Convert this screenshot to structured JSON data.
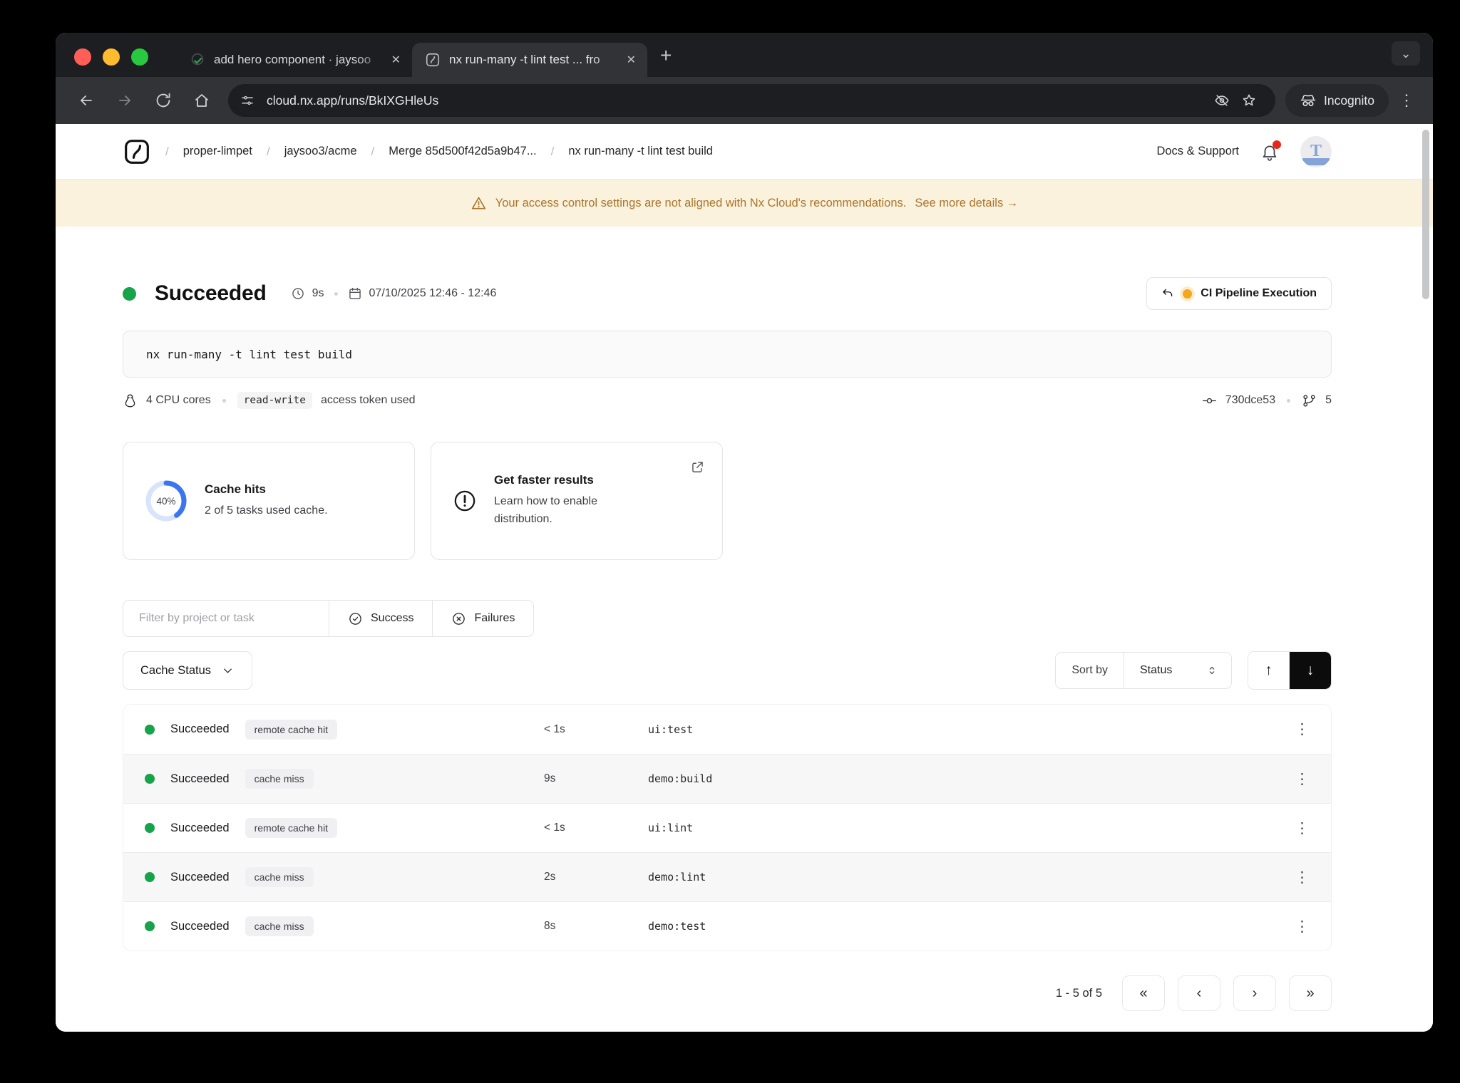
{
  "browser": {
    "tabs": [
      {
        "title": "add hero component · jaysoo",
        "favicon": "pr-check"
      },
      {
        "title": "nx run-many -t lint test ... fro",
        "favicon": "nx-logo"
      }
    ],
    "url": "cloud.nx.app/runs/BkIXGHleUs",
    "incognito_label": "Incognito"
  },
  "header": {
    "separator": "/",
    "breadcrumbs": [
      {
        "label": "proper-limpet"
      },
      {
        "label": "jaysoo3/acme"
      },
      {
        "label": "Merge 85d500f42d5a9b47..."
      },
      {
        "label": "nx run-many -t lint test build"
      }
    ],
    "docs_support": "Docs & Support",
    "avatar_letter": "T"
  },
  "banner": {
    "message": "Your access control settings are not aligned with Nx Cloud's recommendations.",
    "link": "See more details →"
  },
  "run": {
    "status": "Succeeded",
    "duration": "9s",
    "date_range": "07/10/2025 12:46 - 12:46",
    "pipeline_button": "CI Pipeline Execution",
    "command": "nx run-many -t lint test build",
    "cpu": "4 CPU cores",
    "token_badge": "read-write",
    "token_suffix": "access token used",
    "commit": "730dce53",
    "branch_count": "5"
  },
  "cards": {
    "cache": {
      "percent": "40%",
      "title": "Cache hits",
      "subtitle": "2 of 5 tasks used cache."
    },
    "faster": {
      "title": "Get faster results",
      "subtitle": "Learn how to enable distribution."
    }
  },
  "filters": {
    "placeholder": "Filter by project or task",
    "success": "Success",
    "failures": "Failures",
    "cache_status": "Cache Status",
    "sort_by": "Sort by",
    "sort_value": "Status"
  },
  "tasks": {
    "rows": [
      {
        "status": "Succeeded",
        "cache": "remote cache hit",
        "duration": "< 1s",
        "task": "ui:test"
      },
      {
        "status": "Succeeded",
        "cache": "cache miss",
        "duration": "9s",
        "task": "demo:build"
      },
      {
        "status": "Succeeded",
        "cache": "remote cache hit",
        "duration": "< 1s",
        "task": "ui:lint"
      },
      {
        "status": "Succeeded",
        "cache": "cache miss",
        "duration": "2s",
        "task": "demo:lint"
      },
      {
        "status": "Succeeded",
        "cache": "cache miss",
        "duration": "8s",
        "task": "demo:test"
      }
    ],
    "pagination": "1 - 5 of 5"
  },
  "colors": {
    "success_green": "#16a34a",
    "banner_amber": "#a9752b",
    "ring_blue": "#3b76f0",
    "pending_yellow": "#f2a71c",
    "accent_dark": "#0c0c0d"
  }
}
